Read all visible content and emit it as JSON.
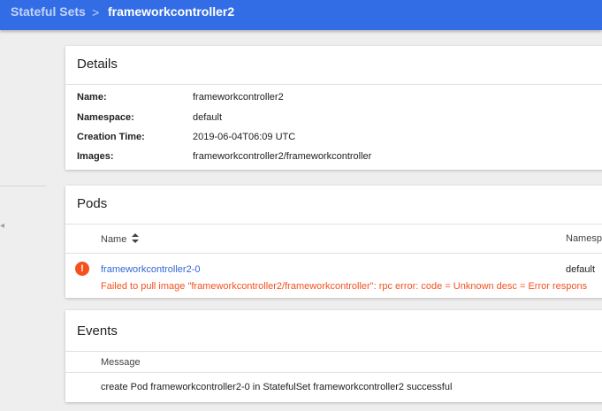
{
  "breadcrumb": {
    "parent": "Stateful Sets",
    "separator": ">",
    "current": "frameworkcontroller2"
  },
  "details": {
    "title": "Details",
    "rows": [
      {
        "label": "Name:",
        "value": "frameworkcontroller2"
      },
      {
        "label": "Namespace:",
        "value": "default"
      },
      {
        "label": "Creation Time:",
        "value": "2019-06-04T06:09 UTC"
      },
      {
        "label": "Images:",
        "value": "frameworkcontroller2/frameworkcontroller"
      }
    ]
  },
  "pods": {
    "title": "Pods",
    "columns": {
      "name": "Name",
      "namespace": "Namesp"
    },
    "rows": [
      {
        "status_icon": "error-icon",
        "status_glyph": "!",
        "name": "frameworkcontroller2-0",
        "namespace": "default",
        "error": "Failed to pull image \"frameworkcontroller2/frameworkcontroller\": rpc error: code = Unknown desc = Error respons"
      }
    ]
  },
  "events": {
    "title": "Events",
    "columns": {
      "message": "Message"
    },
    "rows": [
      {
        "message": "create Pod frameworkcontroller2-0 in StatefulSet frameworkcontroller2 successful"
      }
    ]
  },
  "colors": {
    "topbar": "#326de6",
    "link": "#3367d6",
    "error": "#f4511e"
  }
}
